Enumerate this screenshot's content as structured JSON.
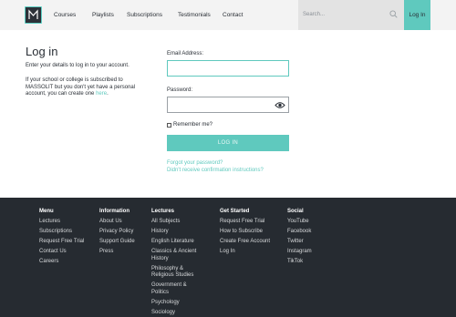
{
  "header": {
    "nav": [
      "Courses",
      "Playlists",
      "Subscriptions",
      "Testimonials",
      "Contact"
    ],
    "search_placeholder": "Search...",
    "login_label": "Log In"
  },
  "main": {
    "title": "Log in",
    "intro": "Enter your details to log in to your account.",
    "school_text": "If your school or college is subscribed to MASSOLIT but you don't yet have a personal account, you can create one",
    "school_link": "here",
    "school_end": ".",
    "email_label": "Email Address:",
    "password_label": "Password:",
    "remember_label": "Remember me?",
    "submit_label": "LOG IN",
    "forgot_label": "Forgot your password?",
    "confirm_label": "Didn't receive confirmation instructions?"
  },
  "footer": {
    "columns": [
      {
        "heading": "Menu",
        "items": [
          "Lectures",
          "Subscriptions",
          "Request Free Trial",
          "Contact Us",
          "Careers"
        ]
      },
      {
        "heading": "Information",
        "items": [
          "About Us",
          "Privacy Policy",
          "Support Guide",
          "Press"
        ]
      },
      {
        "heading": "Lectures",
        "items": [
          "All Subjects",
          "History",
          "English Literature",
          "Classics & Ancient History",
          "Philosophy & Religious Studies",
          "Government & Politics",
          "Psychology",
          "Sociology"
        ]
      },
      {
        "heading": "Get Started",
        "items": [
          "Request Free Trial",
          "How to Subscribe",
          "Create Free Account",
          "Log In"
        ]
      },
      {
        "heading": "Social",
        "items": [
          "YouTube",
          "Facebook",
          "Twitter",
          "Instagram",
          "TikTok"
        ]
      }
    ]
  },
  "colors": {
    "accent": "#5fc9be",
    "footer_bg": "#262b31",
    "header_bg": "#f3f3f3"
  },
  "icons": [
    "massolit-logo-icon",
    "caret-down-icon",
    "search-icon",
    "eye-icon"
  ]
}
